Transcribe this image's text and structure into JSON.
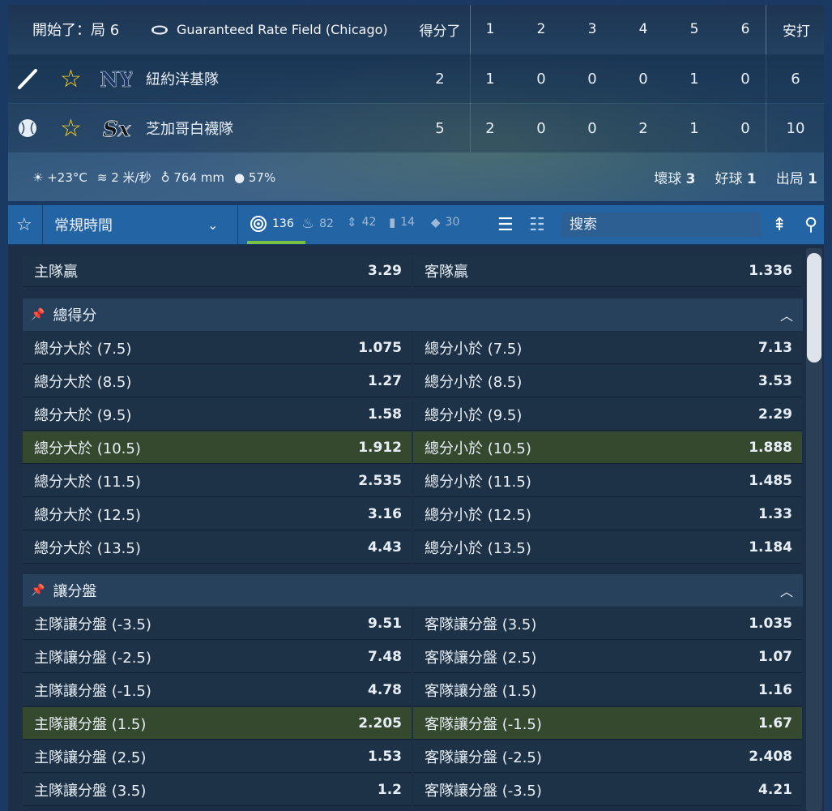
{
  "scoreboard": {
    "status": "開始了：局 6",
    "stadium": "Guaranteed Rate Field (Chicago)",
    "runs_label": "得分了",
    "innings": [
      "1",
      "2",
      "3",
      "4",
      "5",
      "6"
    ],
    "hits_label": "安打",
    "teams": [
      {
        "name": "紐約洋基隊",
        "logo": "yankees-logo",
        "runs": "2",
        "innings": [
          "1",
          "0",
          "0",
          "0",
          "1",
          "0"
        ],
        "hits": "6"
      },
      {
        "name": "芝加哥白襪隊",
        "logo": "whitesox-logo",
        "runs": "5",
        "innings": [
          "2",
          "0",
          "0",
          "2",
          "1",
          "0"
        ],
        "hits": "10"
      }
    ],
    "weather": {
      "temp": "+23°C",
      "wind": "2 米/秒",
      "pressure": "764 mm",
      "humidity": "57%"
    },
    "counts": {
      "balls_label": "壞球",
      "balls": "3",
      "strikes_label": "好球",
      "strikes": "1",
      "outs_label": "出局",
      "outs": "1"
    }
  },
  "toolbar": {
    "period": "常規時間",
    "filters": [
      {
        "icon": "target-icon",
        "count": "136"
      },
      {
        "icon": "fire-icon",
        "count": "82"
      },
      {
        "icon": "updown-icon",
        "count": "42"
      },
      {
        "icon": "bars-icon",
        "count": "14"
      },
      {
        "icon": "diamond-icon",
        "count": "30"
      }
    ],
    "search_placeholder": "搜索"
  },
  "markets": {
    "winner": {
      "home_label": "主隊贏",
      "home_odds": "3.29",
      "away_label": "客隊贏",
      "away_odds": "1.336"
    },
    "totals": {
      "title": "總得分",
      "rows": [
        {
          "over": "總分大於 (7.5)",
          "over_odds": "1.075",
          "under": "總分小於 (7.5)",
          "under_odds": "7.13"
        },
        {
          "over": "總分大於 (8.5)",
          "over_odds": "1.27",
          "under": "總分小於 (8.5)",
          "under_odds": "3.53"
        },
        {
          "over": "總分大於 (9.5)",
          "over_odds": "1.58",
          "under": "總分小於 (9.5)",
          "under_odds": "2.29"
        },
        {
          "over": "總分大於 (10.5)",
          "over_odds": "1.912",
          "under": "總分小於 (10.5)",
          "under_odds": "1.888"
        },
        {
          "over": "總分大於 (11.5)",
          "over_odds": "2.535",
          "under": "總分小於 (11.5)",
          "under_odds": "1.485"
        },
        {
          "over": "總分大於 (12.5)",
          "over_odds": "3.16",
          "under": "總分小於 (12.5)",
          "under_odds": "1.33"
        },
        {
          "over": "總分大於 (13.5)",
          "over_odds": "4.43",
          "under": "總分小於 (13.5)",
          "under_odds": "1.184"
        }
      ]
    },
    "handicap": {
      "title": "讓分盤",
      "rows": [
        {
          "home": "主隊讓分盤 (-3.5)",
          "home_odds": "9.51",
          "away": "客隊讓分盤 (3.5)",
          "away_odds": "1.035"
        },
        {
          "home": "主隊讓分盤 (-2.5)",
          "home_odds": "7.48",
          "away": "客隊讓分盤 (2.5)",
          "away_odds": "1.07"
        },
        {
          "home": "主隊讓分盤 (-1.5)",
          "home_odds": "4.78",
          "away": "客隊讓分盤 (1.5)",
          "away_odds": "1.16"
        },
        {
          "home": "主隊讓分盤 (1.5)",
          "home_odds": "2.205",
          "away": "客隊讓分盤 (-1.5)",
          "away_odds": "1.67"
        },
        {
          "home": "主隊讓分盤 (2.5)",
          "home_odds": "1.53",
          "away": "客隊讓分盤 (-2.5)",
          "away_odds": "2.408"
        },
        {
          "home": "主隊讓分盤 (3.5)",
          "home_odds": "1.2",
          "away": "客隊讓分盤 (-3.5)",
          "away_odds": "4.21"
        }
      ]
    }
  }
}
